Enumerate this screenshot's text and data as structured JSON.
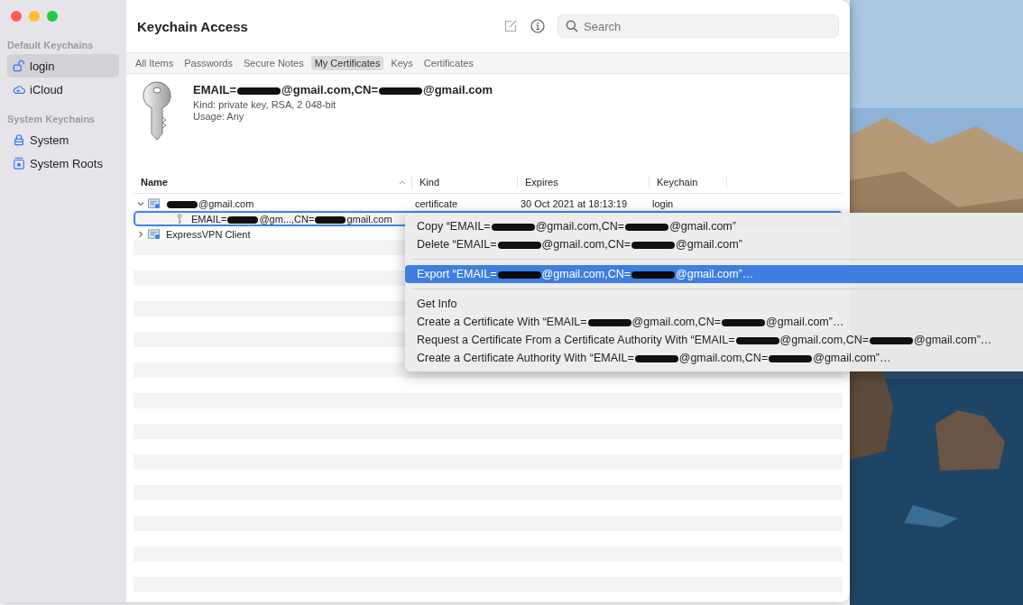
{
  "window": {
    "title": "Keychain Access"
  },
  "sidebar": {
    "sections": [
      {
        "heading": "Default Keychains",
        "items": [
          {
            "label": "login",
            "kind": "lock-open",
            "selected": true
          },
          {
            "label": "iCloud",
            "kind": "cloud",
            "selected": false
          }
        ]
      },
      {
        "heading": "System Keychains",
        "items": [
          {
            "label": "System",
            "kind": "lock",
            "selected": false
          },
          {
            "label": "System Roots",
            "kind": "cabinet",
            "selected": false
          }
        ]
      }
    ]
  },
  "toolbar": {
    "search": {
      "placeholder": "Search"
    }
  },
  "tabs": [
    {
      "label": "All Items",
      "selected": false
    },
    {
      "label": "Passwords",
      "selected": false
    },
    {
      "label": "Secure Notes",
      "selected": false
    },
    {
      "label": "My Certificates",
      "selected": true
    },
    {
      "label": "Keys",
      "selected": false
    },
    {
      "label": "Certificates",
      "selected": false
    }
  ],
  "detail": {
    "title": [
      {
        "kind": "text",
        "text": "EMAIL="
      },
      {
        "kind": "redacted"
      },
      {
        "kind": "text",
        "text": "@gmail.com,CN="
      },
      {
        "kind": "redacted"
      },
      {
        "kind": "text",
        "text": "@gmail.com"
      }
    ],
    "fields": [
      {
        "label": "Kind:",
        "value": "private key, RSA, 2 048-bit"
      },
      {
        "label": "Usage:",
        "value": "Any"
      }
    ]
  },
  "table": {
    "columns": [
      {
        "label": "Name",
        "sorted": true
      },
      {
        "label": "Kind",
        "sorted": false
      },
      {
        "label": "Expires",
        "sorted": false
      },
      {
        "label": "Keychain",
        "sorted": false
      }
    ],
    "rows": [
      {
        "kind": "certificate",
        "name": [
          {
            "kind": "redacted"
          },
          {
            "kind": "text",
            "text": "@gmail.com"
          }
        ],
        "cells": [
          "certificate",
          "30 Oct 2021 at 18:13:19",
          "login"
        ],
        "expanded": true,
        "selected": false,
        "children": [
          {
            "kind": "key",
            "name": [
              {
                "kind": "text",
                "text": "EMAIL="
              },
              {
                "kind": "redacted"
              },
              {
                "kind": "text",
                "text": "@gm...,CN="
              },
              {
                "kind": "redacted"
              },
              {
                "kind": "text",
                "text": "gmail.com"
              }
            ],
            "selected": true
          }
        ]
      },
      {
        "kind": "certificate",
        "name": [
          {
            "kind": "text",
            "text": "ExpressVPN Client"
          }
        ],
        "expanded": false,
        "selected": false
      }
    ]
  },
  "context_menu": {
    "items": [
      {
        "kind": "item",
        "text": [
          {
            "kind": "text",
            "text": "Copy “EMAIL="
          },
          {
            "kind": "redacted"
          },
          {
            "kind": "text",
            "text": "@gmail.com,CN="
          },
          {
            "kind": "redacted"
          },
          {
            "kind": "text",
            "text": "@gmail.com”"
          }
        ],
        "selected": false
      },
      {
        "kind": "item",
        "text": [
          {
            "kind": "text",
            "text": "Delete “EMAIL="
          },
          {
            "kind": "redacted"
          },
          {
            "kind": "text",
            "text": "@gmail.com,CN="
          },
          {
            "kind": "redacted"
          },
          {
            "kind": "text",
            "text": "@gmail.com”"
          }
        ],
        "selected": false
      },
      {
        "kind": "separator"
      },
      {
        "kind": "item",
        "text": [
          {
            "kind": "text",
            "text": "Export “EMAIL="
          },
          {
            "kind": "redacted"
          },
          {
            "kind": "text",
            "text": "@gmail.com,CN="
          },
          {
            "kind": "redacted"
          },
          {
            "kind": "text",
            "text": "@gmail.com”…"
          }
        ],
        "selected": true
      },
      {
        "kind": "separator"
      },
      {
        "kind": "item",
        "text": [
          {
            "kind": "text",
            "text": "Get Info"
          }
        ],
        "selected": false
      },
      {
        "kind": "item",
        "text": [
          {
            "kind": "text",
            "text": "Create a Certificate With “EMAIL="
          },
          {
            "kind": "redacted"
          },
          {
            "kind": "text",
            "text": "@gmail.com,CN="
          },
          {
            "kind": "redacted"
          },
          {
            "kind": "text",
            "text": "@gmail.com”…"
          }
        ],
        "selected": false
      },
      {
        "kind": "item",
        "text": [
          {
            "kind": "text",
            "text": "Request a Certificate From a Certificate Authority With “EMAIL="
          },
          {
            "kind": "redacted"
          },
          {
            "kind": "text",
            "text": "@gmail.com,CN="
          },
          {
            "kind": "redacted"
          },
          {
            "kind": "text",
            "text": "@gmail.com”…"
          }
        ],
        "selected": false
      },
      {
        "kind": "item",
        "text": [
          {
            "kind": "text",
            "text": "Create a Certificate Authority With “EMAIL="
          },
          {
            "kind": "redacted"
          },
          {
            "kind": "text",
            "text": "@gmail.com,CN="
          },
          {
            "kind": "redacted"
          },
          {
            "kind": "text",
            "text": "@gmail.com”…"
          }
        ],
        "selected": false
      }
    ]
  }
}
